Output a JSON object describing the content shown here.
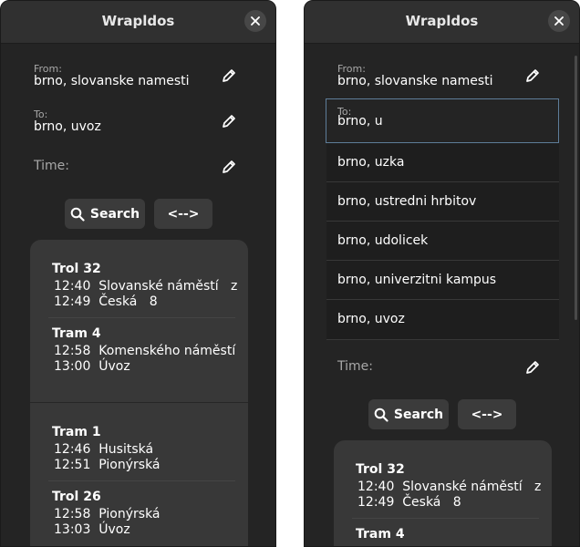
{
  "app": {
    "title": "Wrapldos"
  },
  "labels": {
    "from": "From:",
    "to": "To:",
    "time": "Time:",
    "search": "Search",
    "swap": "<-->"
  },
  "left": {
    "from_value": "brno, slovanske namesti",
    "to_value": "brno, uvoz",
    "results": [
      {
        "legs": [
          {
            "name": "Trol 32",
            "dep_time": "12:40",
            "dep_stop": "Slovanské náměstí   z",
            "arr_time": "12:49",
            "arr_stop": "Česká   8"
          },
          {
            "name": "Tram 4",
            "dep_time": "12:58",
            "dep_stop": "Komenského náměstí",
            "arr_time": "13:00",
            "arr_stop": "Úvoz"
          }
        ]
      },
      {
        "legs": [
          {
            "name": "Tram 1",
            "dep_time": "12:46",
            "dep_stop": "Husitská",
            "arr_time": "12:51",
            "arr_stop": "Pionýrská"
          },
          {
            "name": "Trol 26",
            "dep_time": "12:58",
            "dep_stop": "Pionýrská",
            "arr_time": "13:03",
            "arr_stop": "Úvoz"
          }
        ]
      }
    ]
  },
  "right": {
    "from_value": "brno, slovanske namesti",
    "to_value": "brno, u",
    "suggestions": [
      "brno, uzka",
      "brno, ustredni hrbitov",
      "brno, udolicek",
      "brno, univerzitni kampus",
      "brno, uvoz"
    ],
    "results": [
      {
        "legs": [
          {
            "name": "Trol 32",
            "dep_time": "12:40",
            "dep_stop": "Slovanské náměstí   z",
            "arr_time": "12:49",
            "arr_stop": "Česká   8"
          },
          {
            "name": "Tram 4"
          }
        ]
      }
    ]
  }
}
